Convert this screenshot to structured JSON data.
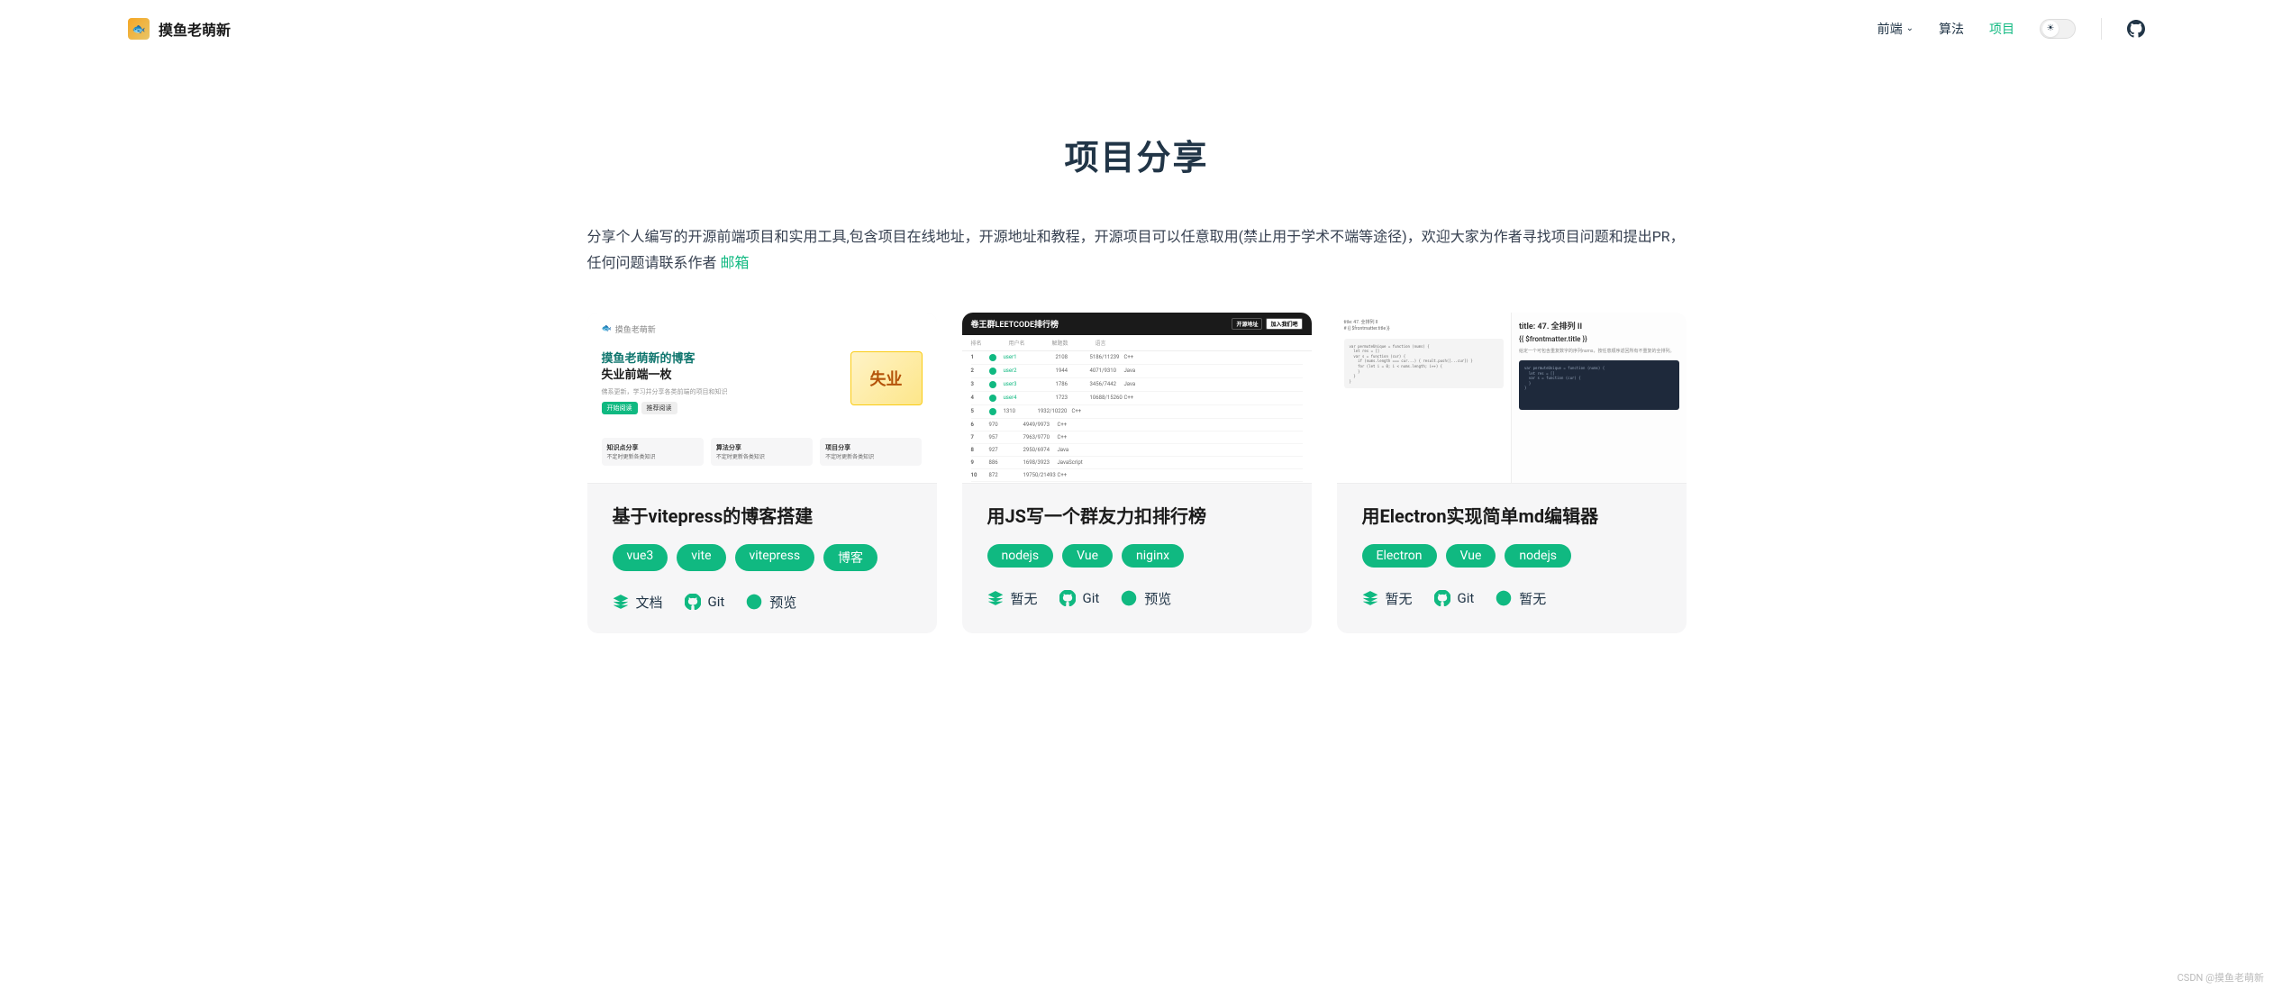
{
  "site": {
    "title": "摸鱼老萌新"
  },
  "nav": {
    "items": [
      {
        "label": "前端",
        "has_dropdown": true,
        "active": false
      },
      {
        "label": "算法",
        "has_dropdown": false,
        "active": false
      },
      {
        "label": "项目",
        "has_dropdown": false,
        "active": true
      }
    ]
  },
  "page": {
    "title": "项目分享",
    "intro_prefix": "分享个人编写的开源前端项目和实用工具,包含项目在线地址，开源地址和教程，开源项目可以任意取用(禁止用于学术不端等途径)，欢迎大家为作者寻找项目问题和提出PR，任何问题请联系作者 ",
    "intro_link": "邮箱"
  },
  "thumb1": {
    "brand": "摸鱼老萌新",
    "hero_line1": "摸鱼老萌新的博客",
    "hero_line2": "失业前端一枚",
    "hero_sub": "佛系更新，学习并分享各类前端的项目和知识",
    "btn1": "开始阅读",
    "btn2": "推荐阅读",
    "img_text": "失业",
    "box1_title": "知识点分享",
    "box2_title": "算法分享",
    "box3_title": "项目分享",
    "box_sub": "不定时更新各类知识"
  },
  "thumb2": {
    "title": "卷王群LEETCODE排行榜",
    "btn1": "开源地址",
    "btn2": "加入我们吧"
  },
  "thumb3": {
    "title_right": "title: 47. 全排列 II",
    "fm": "{{ $frontmatter.title }}"
  },
  "cards": [
    {
      "title": "基于vitepress的博客搭建",
      "tags": [
        "vue3",
        "vite",
        "vitepress",
        "博客"
      ],
      "links": {
        "doc": "文档",
        "git": "Git",
        "preview": "预览"
      }
    },
    {
      "title": "用JS写一个群友力扣排行榜",
      "tags": [
        "nodejs",
        "Vue",
        "niginx"
      ],
      "links": {
        "doc": "暂无",
        "git": "Git",
        "preview": "预览"
      }
    },
    {
      "title": "用Electron实现简单md编辑器",
      "tags": [
        "Electron",
        "Vue",
        "nodejs"
      ],
      "links": {
        "doc": "暂无",
        "git": "Git",
        "preview": "暂无"
      }
    }
  ],
  "watermark": "CSDN @摸鱼老萌新"
}
